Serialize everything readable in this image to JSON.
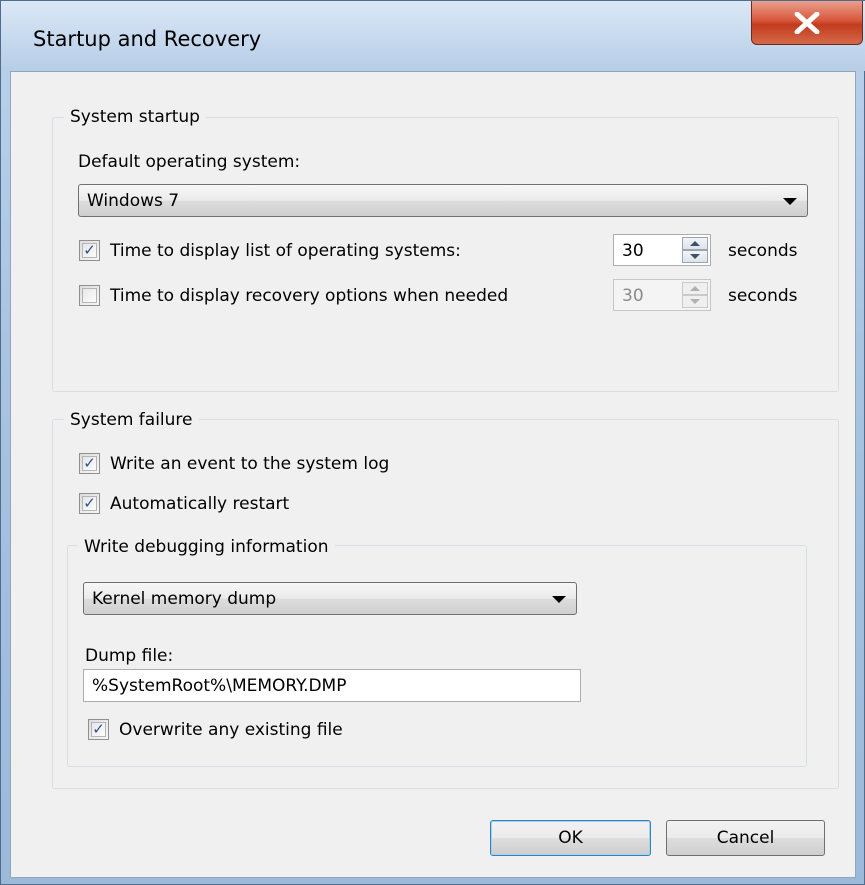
{
  "window": {
    "title": "Startup and Recovery"
  },
  "system_startup": {
    "group_label": "System startup",
    "default_os_label": "Default operating system:",
    "default_os_value": "Windows 7",
    "display_list": {
      "checked": true,
      "label": "Time to display list of operating systems:",
      "value": "30",
      "unit": "seconds"
    },
    "display_recovery": {
      "checked": false,
      "label": "Time to display recovery options when needed",
      "value": "30",
      "unit": "seconds"
    }
  },
  "system_failure": {
    "group_label": "System failure",
    "write_event": {
      "checked": true,
      "label": "Write an event to the system log"
    },
    "auto_restart": {
      "checked": true,
      "label": "Automatically restart"
    },
    "debugging": {
      "group_label": "Write debugging information",
      "dump_type_value": "Kernel memory dump",
      "dump_file_label": "Dump file:",
      "dump_file_value": "%SystemRoot%\\MEMORY.DMP",
      "overwrite": {
        "checked": true,
        "label": "Overwrite any existing file"
      }
    }
  },
  "buttons": {
    "ok_label": "OK",
    "cancel_label": "Cancel"
  },
  "colors": {
    "close_button": "#c23b1e",
    "title_bar": "#c6d9ee",
    "client_background": "#f0f0f0"
  }
}
